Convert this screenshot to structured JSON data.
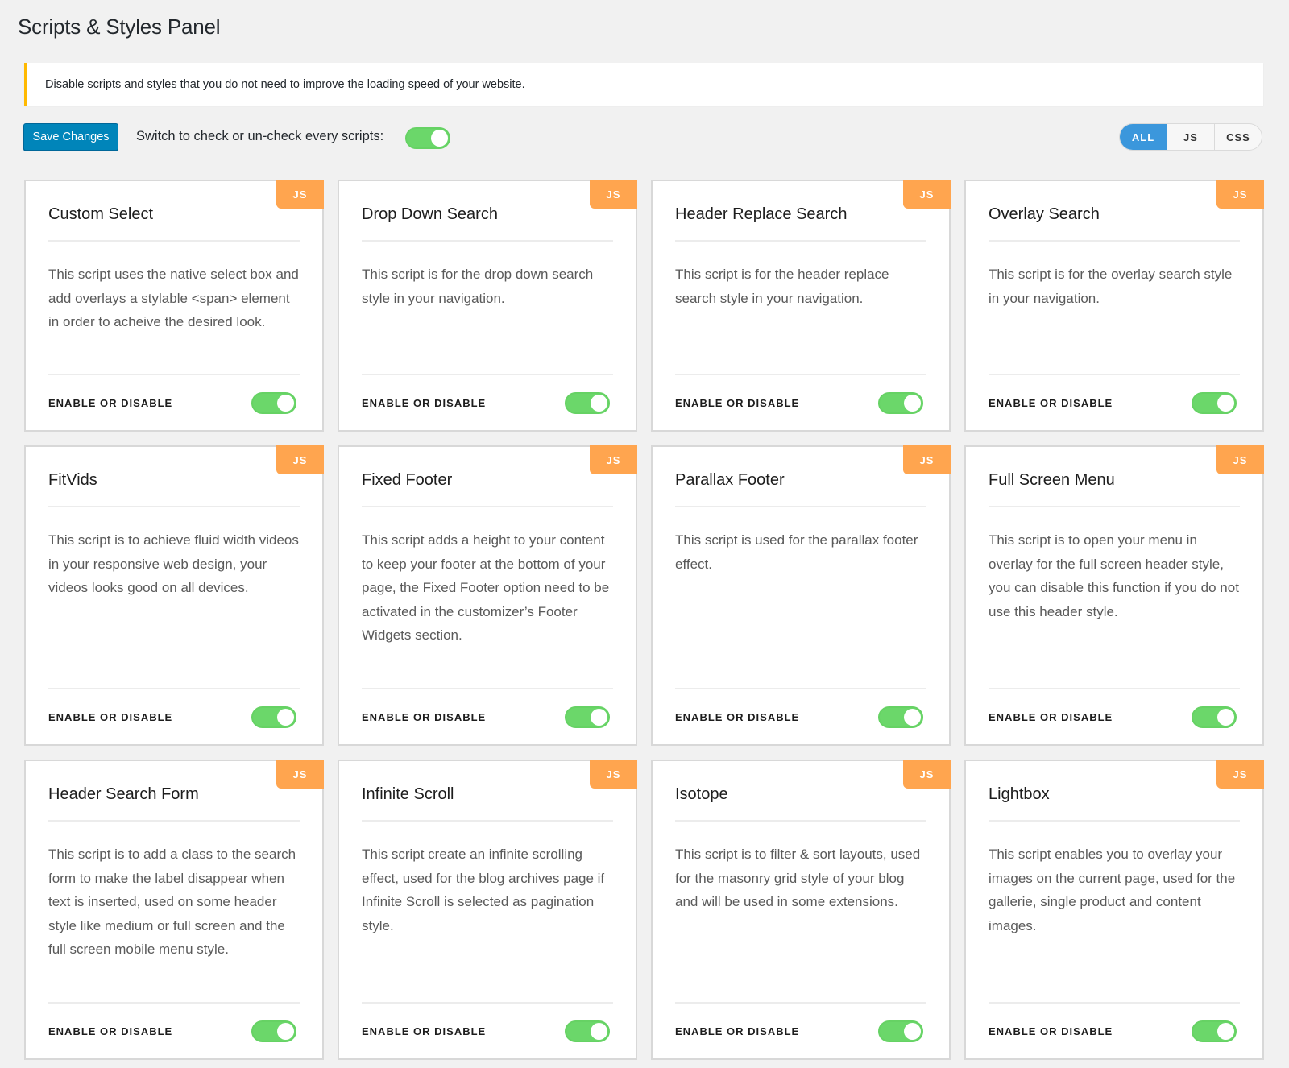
{
  "page": {
    "title": "Scripts & Styles Panel"
  },
  "notice": {
    "text": "Disable scripts and styles that you do not need to improve the loading speed of your website.",
    "accent_color": "#ffb900"
  },
  "toolbar": {
    "save_label": "Save Changes",
    "switch_label": "Switch to check or un-check every scripts:",
    "master_toggle_on": true,
    "filters": [
      {
        "label": "ALL",
        "active": true
      },
      {
        "label": "JS",
        "active": false
      },
      {
        "label": "CSS",
        "active": false
      }
    ]
  },
  "colors": {
    "primary": "#0085ba",
    "filter_active": "#3b97dc",
    "badge": "#ffa54f",
    "toggle_on": "#6bd76a"
  },
  "footer_label": "ENABLE OR DISABLE",
  "cards": [
    {
      "title": "Custom Select",
      "badge": "JS",
      "enabled": true,
      "description": "This script uses the native select box and add overlays a stylable <span> element in order to acheive the desired look."
    },
    {
      "title": "Drop Down Search",
      "badge": "JS",
      "enabled": true,
      "description": "This script is for the drop down search style in your navigation."
    },
    {
      "title": "Header Replace Search",
      "badge": "JS",
      "enabled": true,
      "description": "This script is for the header replace search style in your navigation."
    },
    {
      "title": "Overlay Search",
      "badge": "JS",
      "enabled": true,
      "description": "This script is for the overlay search style in your navigation."
    },
    {
      "title": "FitVids",
      "badge": "JS",
      "enabled": true,
      "description": "This script is to achieve fluid width videos in your responsive web design, your videos looks good on all devices."
    },
    {
      "title": "Fixed Footer",
      "badge": "JS",
      "enabled": true,
      "description": "This script adds a height to your content to keep your footer at the bottom of your page, the Fixed Footer option need to be activated in the customizer’s Footer Widgets section."
    },
    {
      "title": "Parallax Footer",
      "badge": "JS",
      "enabled": true,
      "description": "This script is used for the parallax footer effect."
    },
    {
      "title": "Full Screen Menu",
      "badge": "JS",
      "enabled": true,
      "description": "This script is to open your menu in overlay for the full screen header style, you can disable this function if you do not use this header style."
    },
    {
      "title": "Header Search Form",
      "badge": "JS",
      "enabled": true,
      "description": "This script is to add a class to the search form to make the label disappear when text is inserted, used on some header style like medium or full screen and the full screen mobile menu style."
    },
    {
      "title": "Infinite Scroll",
      "badge": "JS",
      "enabled": true,
      "description": "This script create an infinite scrolling effect, used for the blog archives page if Infinite Scroll is selected as pagination style."
    },
    {
      "title": "Isotope",
      "badge": "JS",
      "enabled": true,
      "description": "This script is to filter & sort layouts, used for the masonry grid style of your blog and will be used in some extensions."
    },
    {
      "title": "Lightbox",
      "badge": "JS",
      "enabled": true,
      "description": "This script enables you to overlay your images on the current page, used for the gallerie, single product and content images."
    }
  ]
}
